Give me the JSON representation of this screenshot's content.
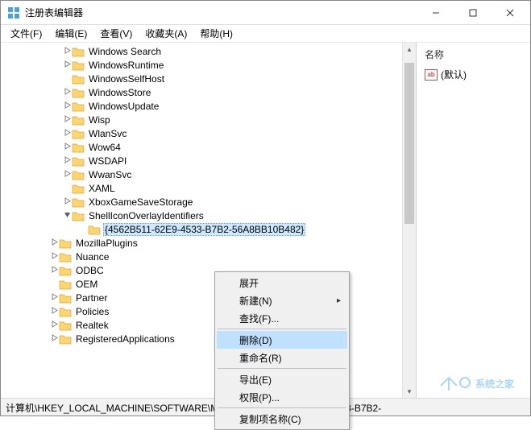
{
  "window": {
    "title": "注册表编辑器"
  },
  "menu": {
    "file": "文件(F)",
    "edit": "编辑(E)",
    "view": "查看(V)",
    "fav": "收藏夹(A)",
    "help": "帮助(H)"
  },
  "right": {
    "header": "名称",
    "default": "(默认)"
  },
  "status": "计算机\\HKEY_LOCAL_MACHINE\\SOFTWARE\\Mic                                            tifiers\\{4562B511-62E9-4533-B7B2-",
  "ctx": {
    "expand": "展开",
    "new": "新建(N)",
    "find": "查找(F)...",
    "delete": "删除(D)",
    "rename": "重命名(R)",
    "export": "导出(E)",
    "perm": "权限(P)...",
    "copy": "复制项名称(C)"
  },
  "tree": [
    {
      "indent": 76,
      "exp": ">",
      "label": "Windows Search"
    },
    {
      "indent": 76,
      "exp": ">",
      "label": "WindowsRuntime"
    },
    {
      "indent": 76,
      "exp": "",
      "label": "WindowsSelfHost"
    },
    {
      "indent": 76,
      "exp": ">",
      "label": "WindowsStore"
    },
    {
      "indent": 76,
      "exp": ">",
      "label": "WindowsUpdate"
    },
    {
      "indent": 76,
      "exp": ">",
      "label": "Wisp"
    },
    {
      "indent": 76,
      "exp": ">",
      "label": "WlanSvc"
    },
    {
      "indent": 76,
      "exp": ">",
      "label": "Wow64"
    },
    {
      "indent": 76,
      "exp": ">",
      "label": "WSDAPI"
    },
    {
      "indent": 76,
      "exp": ">",
      "label": "WwanSvc"
    },
    {
      "indent": 76,
      "exp": "",
      "label": "XAML"
    },
    {
      "indent": 76,
      "exp": ">",
      "label": "XboxGameSaveStorage"
    },
    {
      "indent": 76,
      "exp": "v",
      "label": "ShellIconOverlayIdentifiers"
    },
    {
      "indent": 96,
      "exp": "",
      "label": "{4562B511-62E9-4533-B7B2-56A8BB10B482}",
      "selected": true
    },
    {
      "indent": 60,
      "exp": ">",
      "label": "MozillaPlugins"
    },
    {
      "indent": 60,
      "exp": ">",
      "label": "Nuance"
    },
    {
      "indent": 60,
      "exp": ">",
      "label": "ODBC"
    },
    {
      "indent": 60,
      "exp": "",
      "label": "OEM"
    },
    {
      "indent": 60,
      "exp": ">",
      "label": "Partner"
    },
    {
      "indent": 60,
      "exp": ">",
      "label": "Policies"
    },
    {
      "indent": 60,
      "exp": ">",
      "label": "Realtek"
    },
    {
      "indent": 60,
      "exp": ">",
      "label": "RegisteredApplications"
    }
  ]
}
